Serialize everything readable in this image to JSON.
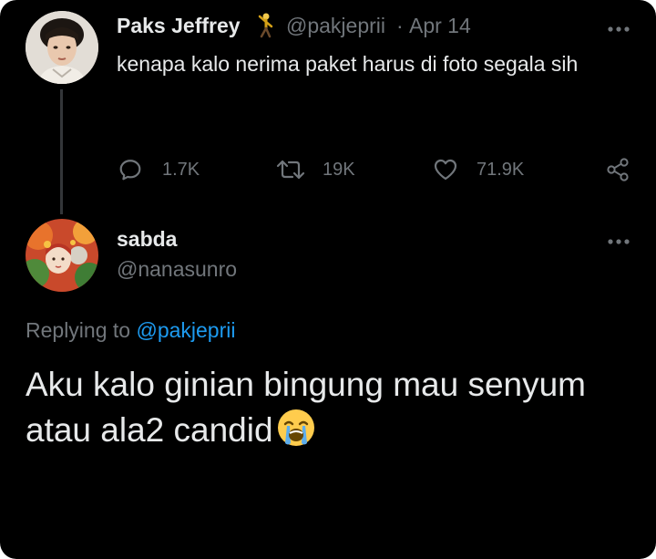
{
  "original_tweet": {
    "author_name": "Paks Jeffrey",
    "author_badge_icon": "person-emoji-icon",
    "handle": "@pakjeprii",
    "separator": "·",
    "date": "Apr 14",
    "text": "kenapa kalo nerima paket harus di foto segala sih",
    "stats": {
      "replies": "1.7K",
      "retweets": "19K",
      "likes": "71.9K"
    }
  },
  "reply_tweet": {
    "author_name": "sabda",
    "handle": "@nanasunro",
    "replying_to_prefix": "Replying to ",
    "replying_to_handle": "@pakjeprii",
    "text": "Aku kalo ginian bingung mau senyum atau ala2 candid",
    "emoji_icon": "loudly-crying-face-icon"
  },
  "colors": {
    "background": "#000000",
    "primary_text": "#e7e9ea",
    "secondary_text": "#71767b",
    "mention": "#1d9bf0",
    "thread_line": "#333639"
  }
}
